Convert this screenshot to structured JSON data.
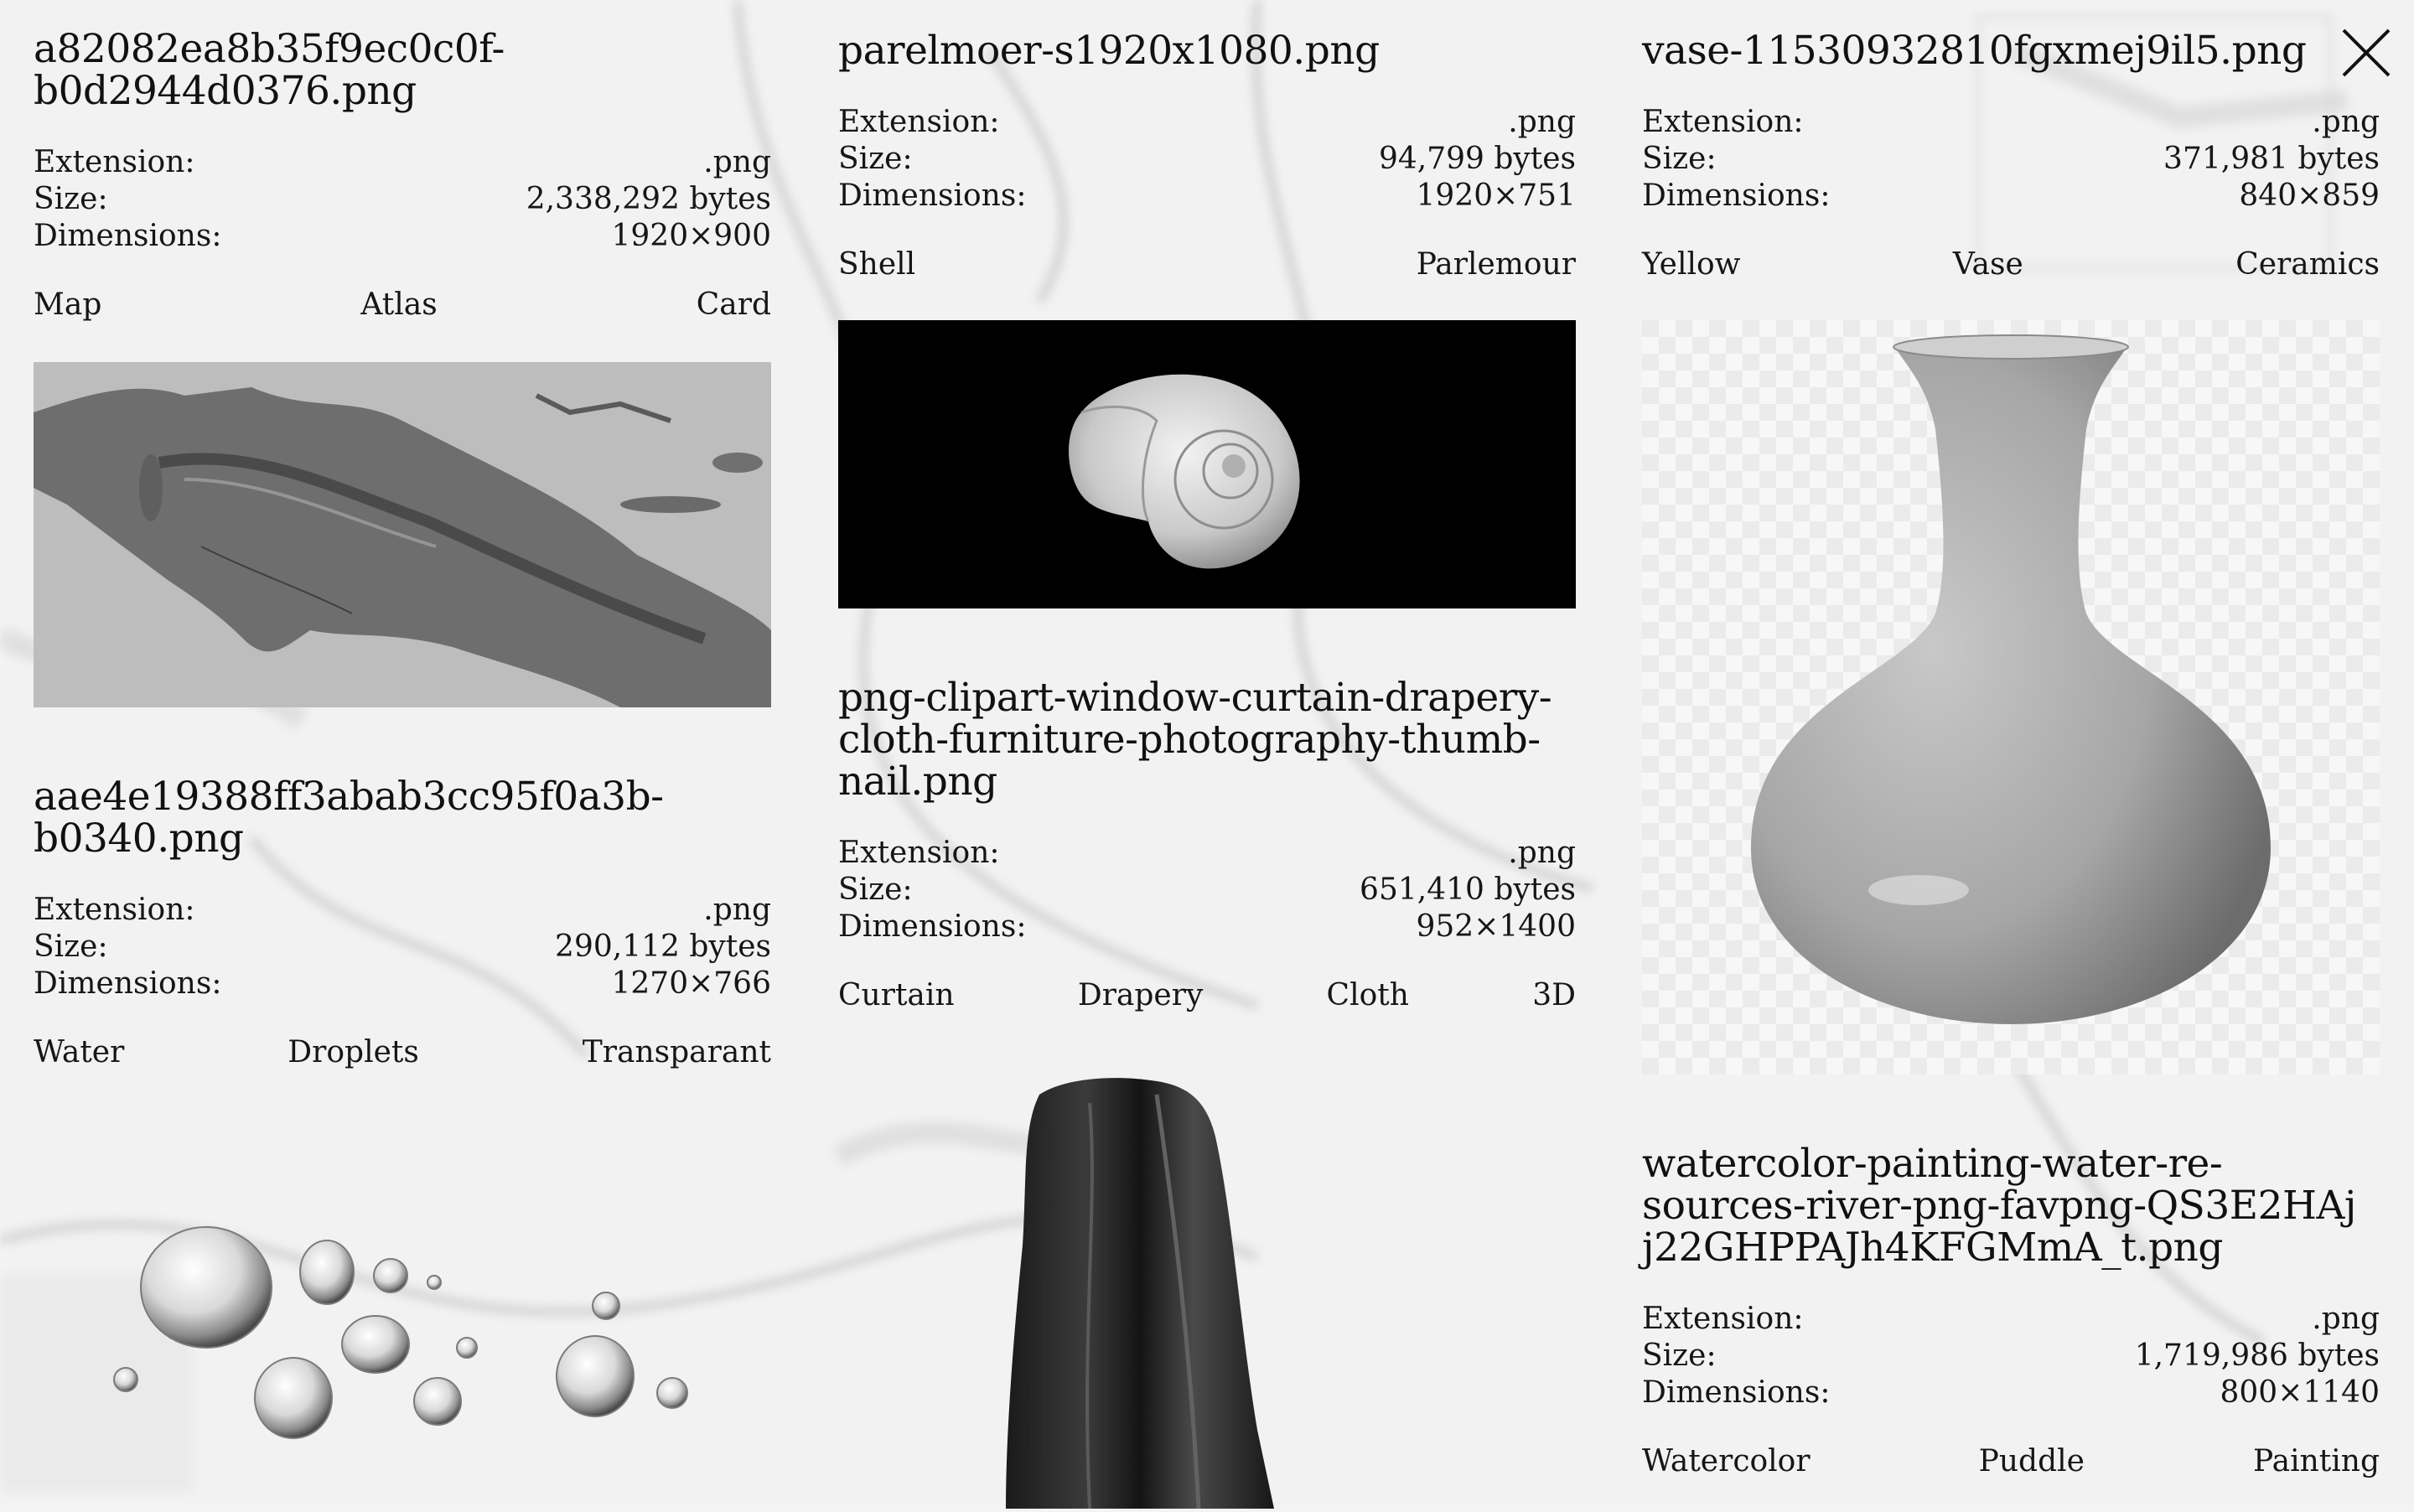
{
  "close_label": "Close",
  "cards": [
    {
      "title": "a82082ea8b35f9ec0c0f-b0d2944d0376.png",
      "meta": {
        "ext_label": "Extension:",
        "ext": ".png",
        "size_label": "Size:",
        "size": "2,338,292 bytes",
        "dim_label": "Dimensions:",
        "dim": "1920×900"
      },
      "tags": [
        "Map",
        "Atlas",
        "Card"
      ]
    },
    {
      "title": "aae4e19388ff3abab3cc95f0a3b-b0340.png",
      "meta": {
        "ext_label": "Extension:",
        "ext": ".png",
        "size_label": "Size:",
        "size": "290,112 bytes",
        "dim_label": "Dimensions:",
        "dim": "1270×766"
      },
      "tags": [
        "Water",
        "Droplets",
        "Transparant"
      ]
    },
    {
      "title": "parelmoer-s1920x1080.png",
      "meta": {
        "ext_label": "Extension:",
        "ext": ".png",
        "size_label": "Size:",
        "size": "94,799 bytes",
        "dim_label": "Dimensions:",
        "dim": "1920×751"
      },
      "tags": [
        "Shell",
        "Parlemour"
      ]
    },
    {
      "title": "png-clipart-window-curtain-drapery-cloth-furniture-photography-thumb-nail.png",
      "meta": {
        "ext_label": "Extension:",
        "ext": ".png",
        "size_label": "Size:",
        "size": "651,410 bytes",
        "dim_label": "Dimensions:",
        "dim": "952×1400"
      },
      "tags": [
        "Curtain",
        "Drapery",
        "Cloth",
        "3D"
      ]
    },
    {
      "title": "vase-11530932810fgxmej9il5.png",
      "meta": {
        "ext_label": "Extension:",
        "ext": ".png",
        "size_label": "Size:",
        "size": "371,981 bytes",
        "dim_label": "Dimensions:",
        "dim": "840×859"
      },
      "tags": [
        "Yellow",
        "Vase",
        "Ceramics"
      ]
    },
    {
      "title": "watercolor-painting-water-re-sources-river-png-favpng-QS3E2HAj j22GHPPAJh4KFGMmA_t.png",
      "meta": {
        "ext_label": "Extension:",
        "ext": ".png",
        "size_label": "Size:",
        "size": "1,719,986 bytes",
        "dim_label": "Dimensions:",
        "dim": "800×1140"
      },
      "tags": [
        "Watercolor",
        "Puddle",
        "Painting"
      ]
    }
  ]
}
